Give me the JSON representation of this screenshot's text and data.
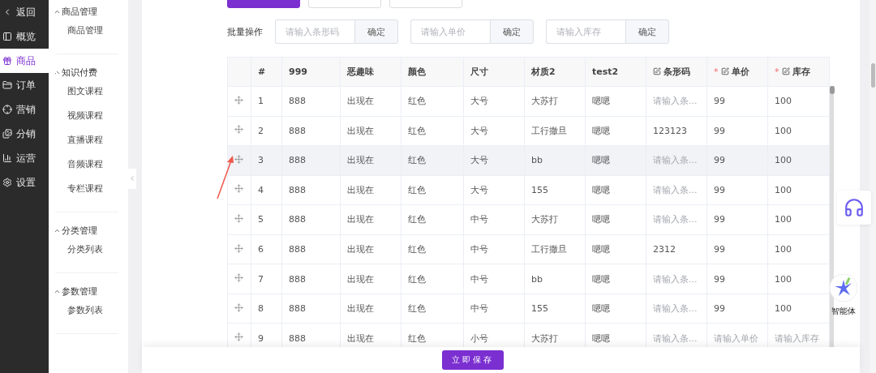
{
  "nav": [
    {
      "label": "返回",
      "kind": "back",
      "selected": false
    },
    {
      "label": "概览",
      "kind": "overview",
      "selected": false
    },
    {
      "label": "商品",
      "kind": "goods",
      "selected": true
    },
    {
      "label": "订单",
      "kind": "order",
      "selected": false
    },
    {
      "label": "营销",
      "kind": "marketing",
      "selected": false
    },
    {
      "label": "分销",
      "kind": "distribution",
      "selected": false
    },
    {
      "label": "运营",
      "kind": "operation",
      "selected": false
    },
    {
      "label": "设置",
      "kind": "settings",
      "selected": false
    }
  ],
  "submenu": [
    {
      "title": "商品管理",
      "expanded": true,
      "items": [
        "商品管理"
      ]
    },
    {
      "title": "知识付费",
      "expanded": true,
      "items": [
        "图文课程",
        "视频课程",
        "直播课程",
        "音频课程",
        "专栏课程"
      ]
    },
    {
      "title": "分类管理",
      "expanded": true,
      "items": [
        "分类列表"
      ]
    },
    {
      "title": "参数管理",
      "expanded": true,
      "items": [
        "参数列表"
      ]
    }
  ],
  "top_buttons": [
    {
      "kind": "primary"
    },
    {
      "kind": "plain"
    },
    {
      "kind": "plain"
    }
  ],
  "batch": {
    "label": "批量操作",
    "fields": [
      {
        "placeholder": "请输入条形码",
        "button": "确定"
      },
      {
        "placeholder": "请输入单价",
        "button": "确定"
      },
      {
        "placeholder": "请输入库存",
        "button": "确定"
      }
    ]
  },
  "table": {
    "columns": [
      {
        "label": "#",
        "editable": false
      },
      {
        "label": "999",
        "editable": false
      },
      {
        "label": "恶趣味",
        "editable": false
      },
      {
        "label": "颜色",
        "editable": false
      },
      {
        "label": "尺寸",
        "editable": false
      },
      {
        "label": "材质2",
        "editable": false
      },
      {
        "label": "test2",
        "editable": false
      },
      {
        "label": "条形码",
        "editable": true
      },
      {
        "label": "单价",
        "editable": true,
        "required_mark": "*"
      },
      {
        "label": "库存",
        "editable": true,
        "required_mark": "*"
      }
    ],
    "rows": [
      {
        "hovered": false,
        "cells": [
          {
            "text": "1"
          },
          {
            "text": "888"
          },
          {
            "text": "出现在"
          },
          {
            "text": "红色"
          },
          {
            "text": "大号"
          },
          {
            "text": "大苏打"
          },
          {
            "text": "嗯嗯"
          },
          {
            "placeholder": "请输入条..."
          },
          {
            "text": "99"
          },
          {
            "text": "100"
          }
        ]
      },
      {
        "hovered": false,
        "cells": [
          {
            "text": "2"
          },
          {
            "text": "888"
          },
          {
            "text": "出现在"
          },
          {
            "text": "红色"
          },
          {
            "text": "大号"
          },
          {
            "text": "工行撒旦"
          },
          {
            "text": "嗯嗯"
          },
          {
            "text": "123123"
          },
          {
            "text": "99"
          },
          {
            "text": "100"
          }
        ]
      },
      {
        "hovered": true,
        "cells": [
          {
            "text": "3"
          },
          {
            "text": "888"
          },
          {
            "text": "出现在"
          },
          {
            "text": "红色"
          },
          {
            "text": "大号"
          },
          {
            "text": "bb"
          },
          {
            "text": "嗯嗯"
          },
          {
            "placeholder": "请输入条..."
          },
          {
            "text": "99"
          },
          {
            "text": "100"
          }
        ]
      },
      {
        "hovered": false,
        "cells": [
          {
            "text": "4"
          },
          {
            "text": "888"
          },
          {
            "text": "出现在"
          },
          {
            "text": "红色"
          },
          {
            "text": "大号"
          },
          {
            "text": "155"
          },
          {
            "text": "嗯嗯"
          },
          {
            "placeholder": "请输入条..."
          },
          {
            "text": "99"
          },
          {
            "text": "100"
          }
        ]
      },
      {
        "hovered": false,
        "cells": [
          {
            "text": "5"
          },
          {
            "text": "888"
          },
          {
            "text": "出现在"
          },
          {
            "text": "红色"
          },
          {
            "text": "中号"
          },
          {
            "text": "大苏打"
          },
          {
            "text": "嗯嗯"
          },
          {
            "placeholder": "请输入条..."
          },
          {
            "text": "99"
          },
          {
            "text": "100"
          }
        ]
      },
      {
        "hovered": false,
        "cells": [
          {
            "text": "6"
          },
          {
            "text": "888"
          },
          {
            "text": "出现在"
          },
          {
            "text": "红色"
          },
          {
            "text": "中号"
          },
          {
            "text": "工行撒旦"
          },
          {
            "text": "嗯嗯"
          },
          {
            "text": "2312"
          },
          {
            "text": "99"
          },
          {
            "text": "100"
          }
        ]
      },
      {
        "hovered": false,
        "cells": [
          {
            "text": "7"
          },
          {
            "text": "888"
          },
          {
            "text": "出现在"
          },
          {
            "text": "红色"
          },
          {
            "text": "中号"
          },
          {
            "text": "bb"
          },
          {
            "text": "嗯嗯"
          },
          {
            "placeholder": "请输入条..."
          },
          {
            "text": "99"
          },
          {
            "text": "100"
          }
        ]
      },
      {
        "hovered": false,
        "cells": [
          {
            "text": "8"
          },
          {
            "text": "888"
          },
          {
            "text": "出现在"
          },
          {
            "text": "红色"
          },
          {
            "text": "中号"
          },
          {
            "text": "155"
          },
          {
            "text": "嗯嗯"
          },
          {
            "placeholder": "请输入条..."
          },
          {
            "text": "99"
          },
          {
            "text": "100"
          }
        ]
      },
      {
        "hovered": false,
        "cells": [
          {
            "text": "9"
          },
          {
            "text": "888"
          },
          {
            "text": "出现在"
          },
          {
            "text": "红色"
          },
          {
            "text": "小号"
          },
          {
            "text": "大苏打"
          },
          {
            "text": "嗯嗯"
          },
          {
            "placeholder": "请输入条..."
          },
          {
            "placeholder": "请输入单价"
          },
          {
            "placeholder": "请输入库存"
          }
        ]
      }
    ]
  },
  "save_button": "立即保存",
  "agent": {
    "label": "智能体"
  }
}
